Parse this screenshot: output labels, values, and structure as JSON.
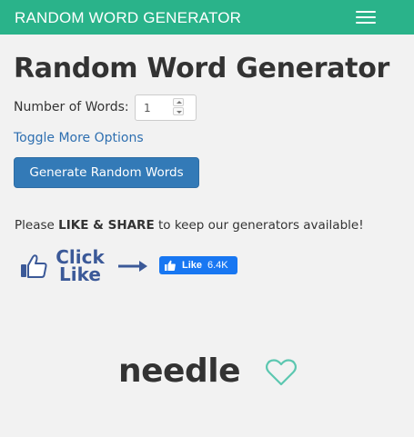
{
  "navbar": {
    "brand": "RANDOM WORD GENERATOR",
    "menu_icon": "hamburger-menu-icon",
    "background": "#2ab38a"
  },
  "main": {
    "title": "Random Word Generator",
    "number_of_words_label": "Number of Words:",
    "number_of_words_value": "1",
    "toggle_options_link": "Toggle More Options",
    "generate_button": "Generate Random Words",
    "button_color": "#337ab7"
  },
  "share": {
    "prefix": "Please ",
    "emphasis": "LIKE & SHARE",
    "suffix": " to keep our generators available!",
    "click_text_line1": "Click",
    "click_text_line2": "Like",
    "thumb_icon": "thumbs-up-icon",
    "arrow_icon": "arrow-right-icon",
    "fb_like_label": "Like",
    "fb_like_count": "6.4K",
    "fb_color": "#1877f2"
  },
  "result": {
    "word": "needle",
    "favorite_icon": "heart-outline-icon",
    "heart_color": "#5cc7b0"
  }
}
